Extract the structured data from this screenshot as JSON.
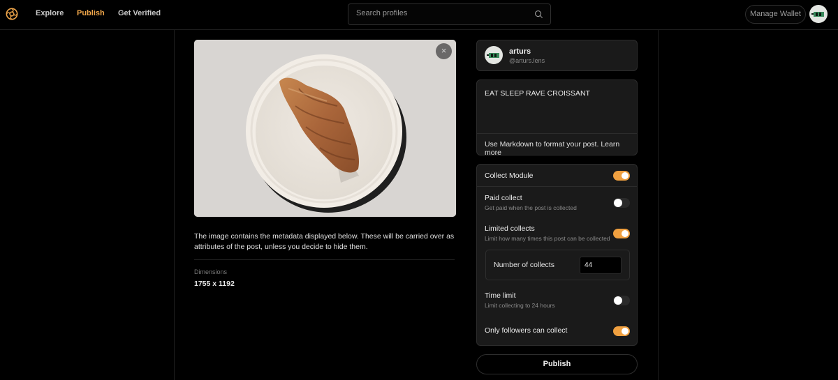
{
  "nav": {
    "logo": "lens-logo-icon",
    "items": [
      {
        "label": "Explore",
        "active": false
      },
      {
        "label": "Publish",
        "active": true
      },
      {
        "label": "Get Verified",
        "active": false
      }
    ],
    "accent_color": "#f0a64a"
  },
  "search": {
    "placeholder": "Search profiles",
    "value": "",
    "icon": "search-icon"
  },
  "header_actions": {
    "wallet_label": "Manage Wallet",
    "avatar": "user-avatar"
  },
  "media": {
    "image_description": "Croissant on a white plate",
    "close_icon": "×",
    "metadata_notice": "The image contains the metadata displayed below. These will be carried over as attributes of the post, unless you decide to hide them.",
    "dimensions_label": "Dimensions",
    "dimensions_value": "1755 x 1192"
  },
  "profile": {
    "name": "arturs",
    "handle": "@arturs.lens"
  },
  "editor": {
    "content": "EAT SLEEP RAVE CROISSANT",
    "help_prefix": "Use Markdown to format your post. ",
    "help_link": "Learn more"
  },
  "collect": {
    "module_label": "Collect Module",
    "module_enabled": true,
    "paid": {
      "title": "Paid collect",
      "subtitle": "Get paid when the post is collected",
      "enabled": false
    },
    "limited": {
      "title": "Limited collects",
      "subtitle": "Limit how many times this post can be collected",
      "enabled": true
    },
    "number_label": "Number of collects",
    "number_value": "44",
    "time_limit": {
      "title": "Time limit",
      "subtitle": "Limit collecting to 24 hours",
      "enabled": false
    },
    "followers_only": {
      "title": "Only followers can collect",
      "enabled": true
    },
    "toggle_on_color": "#f0a040"
  },
  "actions": {
    "publish_label": "Publish"
  }
}
